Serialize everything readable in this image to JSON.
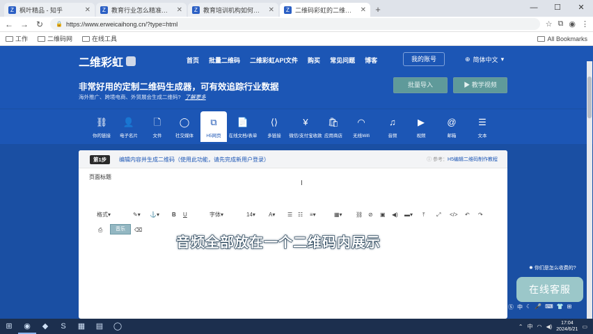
{
  "browser": {
    "tabs": [
      {
        "title": "枫叶精品 - 知乎",
        "favicon": "Z"
      },
      {
        "title": "教育行业怎么精准获客? 知乎",
        "favicon": "Z"
      },
      {
        "title": "教育培训机构如何做好引流获客",
        "favicon": "Z"
      },
      {
        "title": "二维码彩虹的二维码生成器",
        "favicon": "Z",
        "active": true
      }
    ],
    "new_tab": "+",
    "url": "https://www.erweicaihong.cn/?type=html",
    "bookmarks": [
      "工作",
      "二维码网",
      "在线工具"
    ],
    "all_bookmarks": "All Bookmarks",
    "window_controls": [
      "—",
      "☐",
      "✕"
    ]
  },
  "site": {
    "logo": "二维彩虹",
    "menu": [
      "首页",
      "批量二维码",
      "二维彩虹API文件",
      "购买",
      "常见问题",
      "博客"
    ],
    "login": "我的账号",
    "language": "简体中文",
    "banner_title": "非常好用的定制二维码生成器，可有效追踪行业数据",
    "banner_sub": "海外推广、跨境电商、外贸展会生成二维码?",
    "banner_learn": "了解更多",
    "btn_batch": "批量导入",
    "btn_video": "▶ 教学视频",
    "icons": [
      {
        "label": "你的链接",
        "icon": "⛓"
      },
      {
        "label": "电子名片",
        "icon": "👤"
      },
      {
        "label": "文件",
        "icon": "🗋"
      },
      {
        "label": "社交媒体",
        "icon": "◯"
      },
      {
        "label": "H5网页",
        "icon": "⧉",
        "active": true
      },
      {
        "label": "在线文档/表单",
        "icon": "📄"
      },
      {
        "label": "多链接",
        "icon": "⟨⟩"
      },
      {
        "label": "微信/支付宝收款",
        "icon": "¥"
      },
      {
        "label": "应用商店",
        "icon": "🛍"
      },
      {
        "label": "无线Wifi",
        "icon": "◠"
      },
      {
        "label": "音频",
        "icon": "♫"
      },
      {
        "label": "视频",
        "icon": "▶"
      },
      {
        "label": "邮箱",
        "icon": "@"
      },
      {
        "label": "文本",
        "icon": "☰"
      }
    ]
  },
  "panel": {
    "step_badge": "第1步",
    "step_text": "编辑内容并生成二维码（使用此功能，请先完成新用户登录）",
    "step_ref_prefix": "参考：",
    "step_ref_link": "H5编辑二维码制作教程",
    "page_title_label": "页面标题",
    "cursor": "I",
    "toolbar": {
      "font_style": "格式▾",
      "font_family": "字体▾",
      "font_size": "14▾",
      "bold": "B",
      "underline": "U",
      "music_btn": "音乐"
    }
  },
  "caption": "音频全部放在一个二维码内展示",
  "help_link": "你们是怎么收费的?",
  "chat_button": "在线客服",
  "taskbar": {
    "time": "17:04",
    "date": "2024/6/21"
  }
}
